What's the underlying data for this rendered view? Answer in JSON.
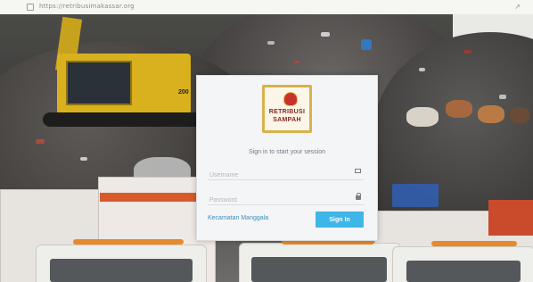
{
  "browser": {
    "url": "https://retribusimakassar.org",
    "extension_glyph": "↗"
  },
  "background": {
    "excavator_text": "200"
  },
  "login": {
    "logo_line1": "RETRIBUSI",
    "logo_line2": "SAMPAH",
    "subtitle": "Sign in to start your session",
    "username_placeholder": "Username",
    "password_placeholder": "Password",
    "district_link": "Kecamatan Manggala",
    "signin_label": "Sign In",
    "icons": {
      "username": "envelope-icon",
      "password": "lock-icon"
    },
    "colors": {
      "accent": "#3fb6e8",
      "link": "#3c8dbc",
      "logo_border": "#d7b24a",
      "logo_text": "#8a2420"
    }
  }
}
